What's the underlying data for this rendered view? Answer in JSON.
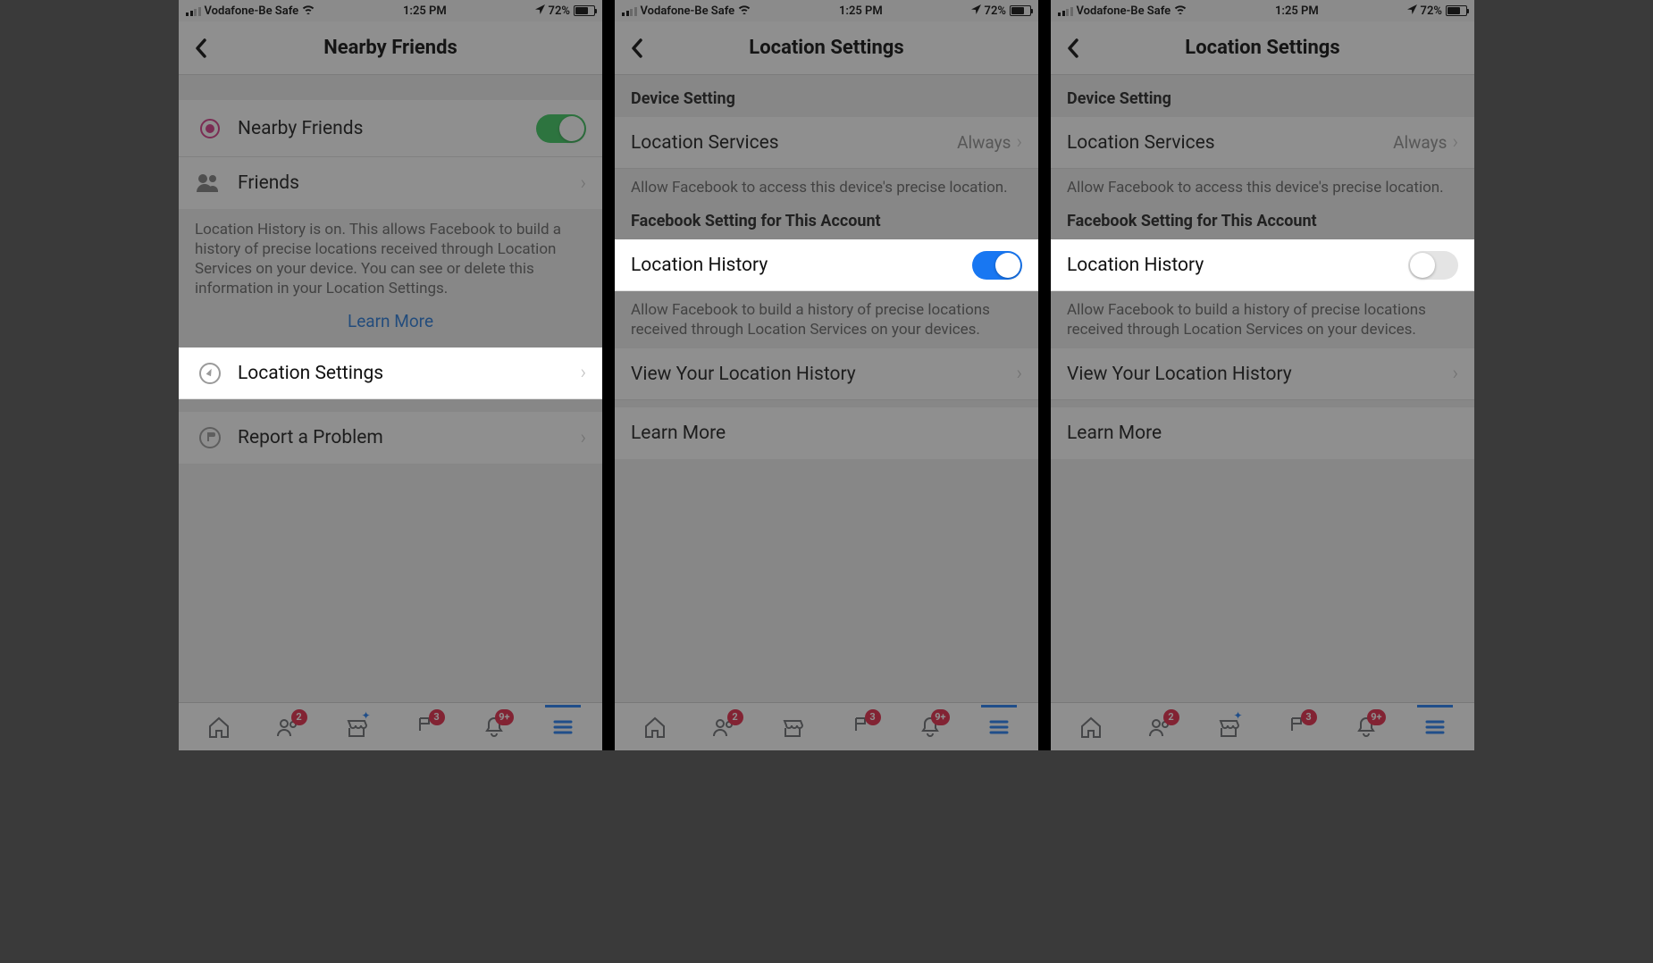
{
  "status": {
    "carrier": "Vodafone-Be Safe",
    "time": "1:25 PM",
    "battery_pct": "72%",
    "battery_fill": 72
  },
  "screens": [
    {
      "title": "Nearby Friends",
      "nearby_friends_label": "Nearby Friends",
      "nearby_friends_on": true,
      "friends_label": "Friends",
      "history_info": "Location History is on. This allows Facebook to build a history of precise locations received through Location Services on your device. You can see or delete this information in your Location Settings.",
      "learn_more": "Learn More",
      "location_settings_label": "Location Settings",
      "report_problem_label": "Report a Problem"
    },
    {
      "title": "Location Settings",
      "device_setting_header": "Device Setting",
      "location_services_label": "Location Services",
      "location_services_value": "Always",
      "device_desc": "Allow Facebook to access this device's precise location.",
      "fb_setting_header": "Facebook Setting for This Account",
      "location_history_label": "Location History",
      "location_history_on": true,
      "history_desc": "Allow Facebook to build a history of precise locations received through Location Services on your devices.",
      "view_history_label": "View Your Location History",
      "learn_more_label": "Learn More"
    },
    {
      "title": "Location Settings",
      "device_setting_header": "Device Setting",
      "location_services_label": "Location Services",
      "location_services_value": "Always",
      "device_desc": "Allow Facebook to access this device's precise location.",
      "fb_setting_header": "Facebook Setting for This Account",
      "location_history_label": "Location History",
      "location_history_on": false,
      "history_desc": "Allow Facebook to build a history of precise locations received through Location Services on your devices.",
      "view_history_label": "View Your Location History",
      "learn_more_label": "Learn More"
    }
  ],
  "tabs": {
    "badges": {
      "friends": "2",
      "groups": "3",
      "notifications": "9+"
    }
  }
}
